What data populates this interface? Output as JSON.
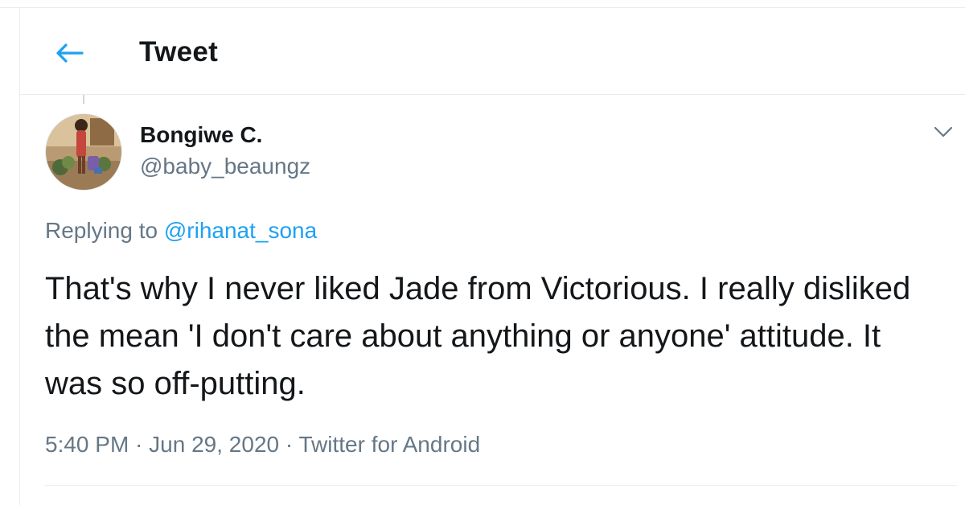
{
  "header": {
    "title": "Tweet",
    "back_icon": "arrow-left-icon"
  },
  "tweet": {
    "author": {
      "display_name": "Bongiwe C.",
      "handle": "@baby_beaungz",
      "avatar": "profile-photo"
    },
    "more_icon": "chevron-down-icon",
    "reply_prefix": "Replying to",
    "reply_to": "@rihanat_sona",
    "text": "That's why I never liked Jade from Victorious. I really disliked the mean 'I don't care about anything or anyone' attitude. It was so off-putting.",
    "time": "5:40 PM",
    "date": "Jun 29, 2020",
    "source": "Twitter for Android",
    "separator": " · "
  },
  "colors": {
    "accent": "#1da1f2",
    "secondary_text": "#657786",
    "primary_text": "#14171a",
    "border": "#e6ecf0"
  }
}
